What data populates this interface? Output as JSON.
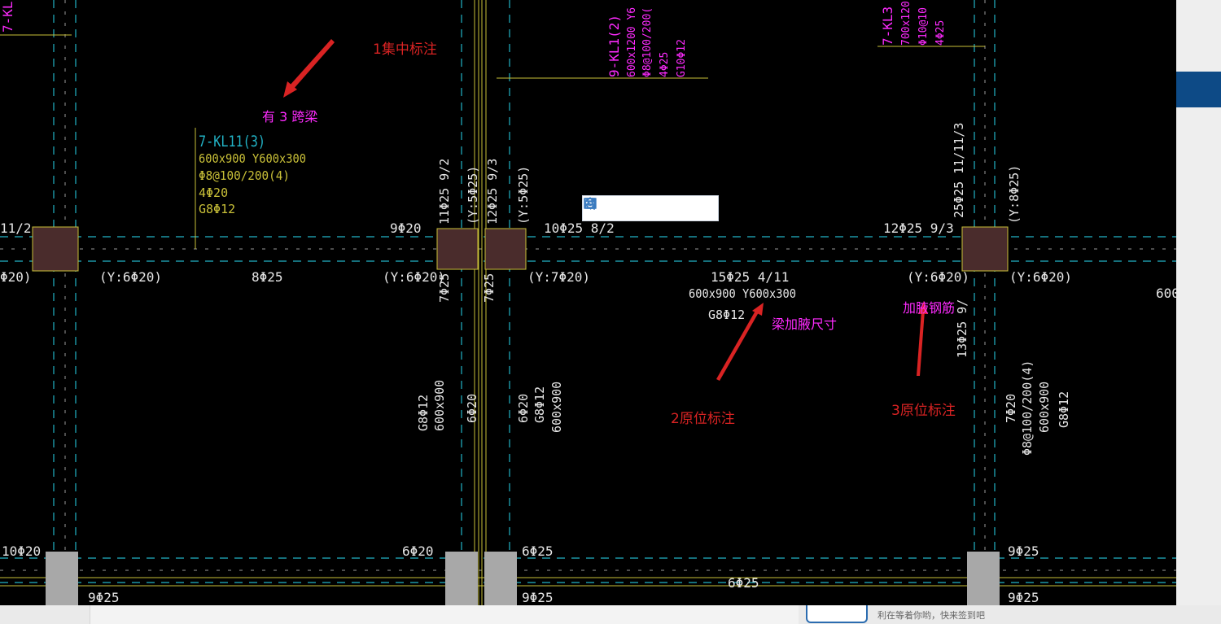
{
  "drawing": {
    "beam_center_title": "7-KL11(3)",
    "beam_center_lines": [
      "600x900 Y600x300",
      "Φ8@100/200(4)",
      "4Φ20",
      "G8Φ12"
    ],
    "top_mid_title": "9-KL1(2)",
    "top_mid_lines": [
      "600x1200 Y6",
      "Φ8@100/200(",
      "4Φ25",
      "G10Φ12"
    ],
    "top_right_title": "7-KL3",
    "top_right_lines": [
      "700x120",
      "Φ10@10",
      "4Φ25"
    ],
    "top_left_title": "7-KL",
    "main_beam_top": [
      "11/2",
      "9Φ20",
      "11Φ25 9/2",
      "(Y:5Φ25)",
      "12Φ25 9/3",
      "(Y:5Φ25)",
      "10Φ25 8/2",
      "12Φ25 9/3",
      "25Φ25 11/11/3",
      "(Y:8Φ25)"
    ],
    "main_beam_bottom": [
      "Φ20)",
      "(Y:6Φ20)",
      "8Φ25",
      "(Y:6Φ20)",
      "(Y:7Φ20)",
      "15Φ25 4/11",
      "(Y:6Φ20)",
      "(Y:6Φ20)",
      "600"
    ],
    "mid_span_lines": [
      "600x900 Y600x300",
      "G8Φ12"
    ],
    "vertical_left": [
      "7Φ25",
      "7Φ25"
    ],
    "col_left_texts": [
      "G8Φ12",
      "600x900"
    ],
    "col_mid1": "6Φ20",
    "col_mid2": [
      "6Φ20",
      "G8Φ12",
      "600x900"
    ],
    "col_right_v": "13Φ25 9/",
    "col_right": [
      "7Φ20",
      "Φ8@100/200(4)",
      "600x900",
      "G8Φ12"
    ],
    "bottom_beam_top": [
      "10Φ20",
      "6Φ20",
      "6Φ25",
      "9Φ25"
    ],
    "bottom_beam_bottom": [
      "9Φ25",
      "9Φ25",
      "6Φ25",
      "9Φ25"
    ]
  },
  "annotations": {
    "label_1": "1集中标注",
    "label_span": "有 3 跨梁",
    "label_2": "2原位标注",
    "label_haunch_size": "梁加腋尺寸",
    "label_3": "3原位标注",
    "label_haunch_rebar": "加腋钢筋"
  },
  "toolbar": {
    "icons": [
      "image-add-icon",
      "save-icon",
      "copy-icon",
      "image-icon",
      "settings-icon"
    ]
  },
  "promo_text": "利在等着你哟，快来签到吧",
  "colors": {
    "background": "#000000",
    "axis": "#22b3c6",
    "beam": "#c9c038",
    "text_white": "#e6e6e6",
    "magenta": "#ff2bff",
    "annotation_red": "#d92323",
    "column_fill": "#4a2c2c",
    "column_grey": "#a8a8a8",
    "side_blue": "#0d4a86"
  }
}
